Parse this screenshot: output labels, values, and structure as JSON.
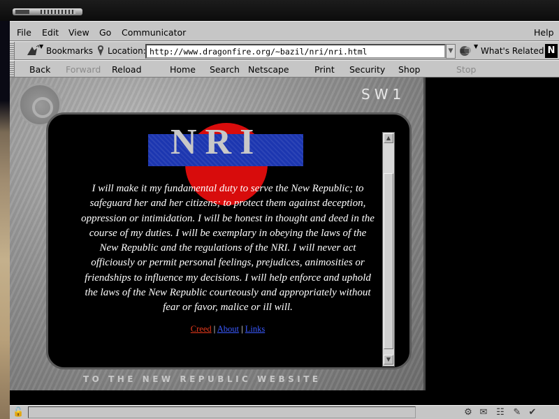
{
  "menu": [
    "File",
    "Edit",
    "View",
    "Go",
    "Communicator"
  ],
  "help": "Help",
  "locbar": {
    "bookmarks": "Bookmarks",
    "location_label": "Location:",
    "url": "http://www.dragonfire.org/~bazil/nri/nri.html",
    "whats_related": "What's Related",
    "netscape_logo": "N"
  },
  "nav": {
    "back": "Back",
    "forward": "Forward",
    "reload": "Reload",
    "home": "Home",
    "search": "Search",
    "netscape": "Netscape",
    "print": "Print",
    "security": "Security",
    "shop": "Shop",
    "stop": "Stop"
  },
  "page": {
    "frame_label": "SW1",
    "logo_text": "NRI",
    "oath": "I will make it my fundamental duty to serve the New Republic; to safeguard her and her citizens; to protect them against deception, oppression or intimidation. I will be honest in thought and deed in the course of my duties. I will be exemplary in obeying the laws of the New Republic and the regulations of the NRI. I will never act officiously or permit personal feelings, prejudices, animosities or friendships to influence my decisions. I will help enforce and uphold the laws of the New Republic courteously and appropriately without fear or favor, malice or ill will.",
    "links": {
      "creed": "Creed",
      "sep1": " | ",
      "about": "About",
      "sep2": " | ",
      "links": "Links"
    },
    "footer": "TO THE NEW REPUBLIC WEBSITE"
  },
  "colors": {
    "chrome": "#c6c6c6",
    "logo_blue": "#1c36b0",
    "logo_red": "#d80c0c",
    "link": "#3a5aff",
    "visited_link": "#e83a1c"
  },
  "icons": [
    "bookmarks-icon",
    "location-icon",
    "whats-related-icon",
    "netscape-logo-icon",
    "security-lock-icon",
    "rebel-emblem-icon"
  ]
}
